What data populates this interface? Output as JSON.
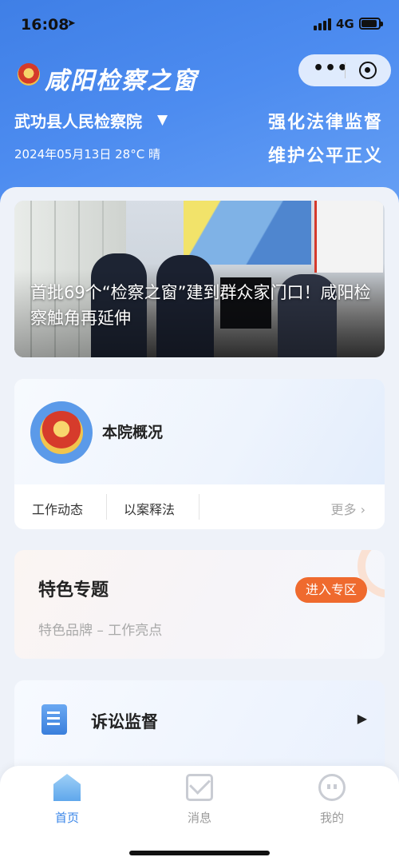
{
  "status_bar": {
    "time": "16:08",
    "network": "4G"
  },
  "header": {
    "app_title": "咸阳检察之窗",
    "court_name": "武功县人民检察院",
    "date_weather": "2024年05月13日 28°C 晴",
    "slogan_line1": "强化法律监督",
    "slogan_line2": "维护公平正义",
    "capsule_more_icon": "more-dots-icon",
    "capsule_close_icon": "target-icon"
  },
  "banner": {
    "title": "首批69个“检察之窗”建到群众家门口！咸阳检察触角再延伸"
  },
  "overview": {
    "label": "本院概况",
    "tabs": [
      "工作动态",
      "以案释法"
    ],
    "more": "更多"
  },
  "special": {
    "title": "特色专题",
    "subtitle": "特色品牌 – 工作亮点",
    "button": "进入专区",
    "button_color": "#ef6a2e"
  },
  "litigation": {
    "label": "诉讼监督"
  },
  "tabbar": {
    "items": [
      {
        "label": "首页",
        "icon": "home-icon",
        "active": true
      },
      {
        "label": "消息",
        "icon": "mail-icon",
        "active": false
      },
      {
        "label": "我的",
        "icon": "user-icon",
        "active": false
      }
    ],
    "active_color": "#3a86e8",
    "inactive_color": "#9a9a9a"
  },
  "colors": {
    "brand_blue": "#4d8cf0",
    "background": "#eef2f9"
  }
}
